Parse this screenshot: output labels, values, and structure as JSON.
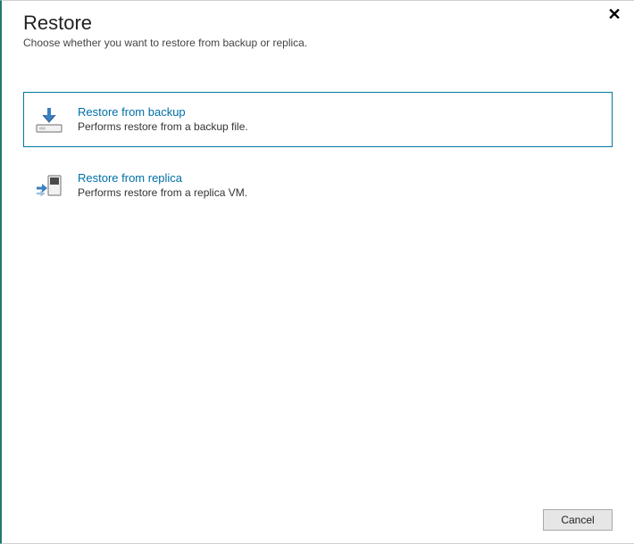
{
  "header": {
    "title": "Restore",
    "subtitle": "Choose whether you want to restore from backup or replica."
  },
  "options": {
    "backup": {
      "title": "Restore from backup",
      "desc": "Performs restore from a backup file."
    },
    "replica": {
      "title": "Restore from replica",
      "desc": "Performs restore from a replica VM."
    }
  },
  "footer": {
    "cancel": "Cancel"
  }
}
